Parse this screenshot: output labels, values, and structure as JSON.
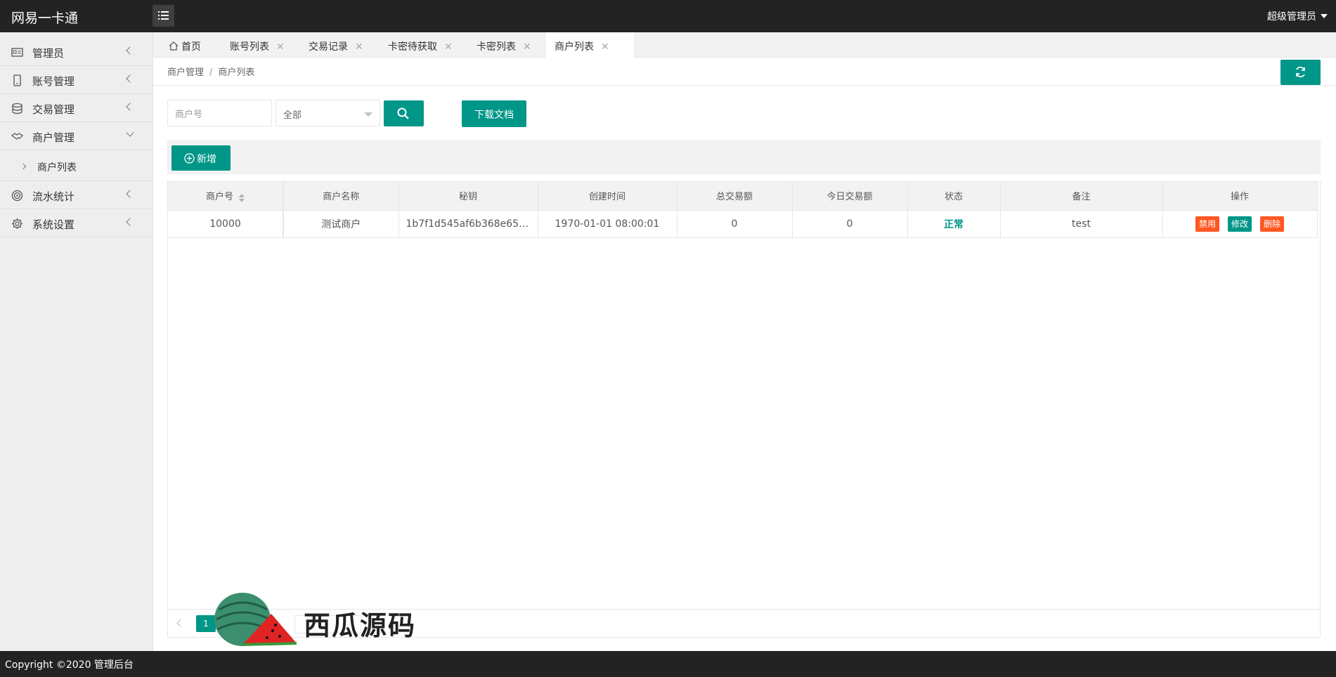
{
  "header": {
    "app_title": "网易一卡通",
    "user_label": "超级管理员"
  },
  "sidebar": {
    "items": [
      {
        "label": "管理员",
        "icon": "id-card-icon"
      },
      {
        "label": "账号管理",
        "icon": "phone-icon"
      },
      {
        "label": "交易管理",
        "icon": "database-icon"
      },
      {
        "label": "商户管理",
        "icon": "handshake-icon"
      },
      {
        "label": "流水统计",
        "icon": "target-icon"
      },
      {
        "label": "系统设置",
        "icon": "gear-icon"
      }
    ],
    "sub_item": "商户列表"
  },
  "tabs": [
    {
      "label": "首页"
    },
    {
      "label": "账号列表"
    },
    {
      "label": "交易记录"
    },
    {
      "label": "卡密待获取"
    },
    {
      "label": "卡密列表"
    },
    {
      "label": "商户列表"
    }
  ],
  "breadcrumb": {
    "parent": "商户管理",
    "current": "商户列表"
  },
  "search": {
    "placeholder": "商户号",
    "select_value": "全部",
    "download_label": "下载文档"
  },
  "toolbar": {
    "add_label": "新增"
  },
  "table": {
    "headers": [
      "商户号",
      "商户名称",
      "秘钥",
      "创建时间",
      "总交易额",
      "今日交易额",
      "状态",
      "备注",
      "操作"
    ],
    "rows": [
      {
        "merchant_id": "10000",
        "name": "测试商户",
        "secret": "1b7f1d545af6b368e65b…",
        "created": "1970-01-01 08:00:01",
        "total": "0",
        "today": "0",
        "status": "正常",
        "remark": "test",
        "actions": [
          "禁用",
          "修改",
          "删除"
        ]
      }
    ]
  },
  "pager": {
    "current_page": "1"
  },
  "watermark": {
    "text": "西瓜源码"
  },
  "footer": {
    "copyright": "Copyright ©2020 管理后台"
  },
  "colors": {
    "primary": "#009688",
    "danger": "#ff5722",
    "header_bg": "#232323"
  }
}
